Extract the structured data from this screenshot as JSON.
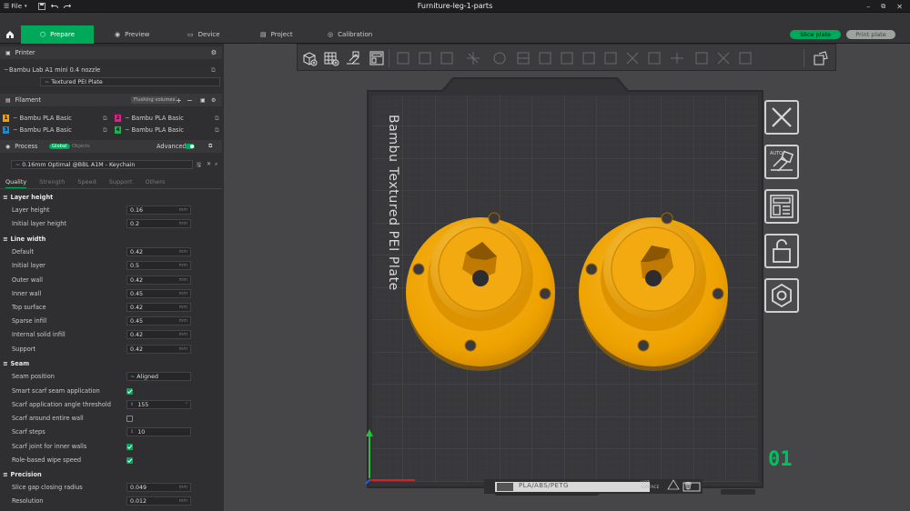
{
  "app": {
    "title": "Furniture-leg-1-parts",
    "menu_file": "File"
  },
  "tabs": [
    {
      "label": "Prepare",
      "icon": "cube-icon"
    },
    {
      "label": "Preview",
      "icon": "eye-icon"
    },
    {
      "label": "Device",
      "icon": "device-icon"
    },
    {
      "label": "Project",
      "icon": "project-icon"
    },
    {
      "label": "Calibration",
      "icon": "calibration-icon"
    }
  ],
  "actions": {
    "slice_plate": "Slice plate",
    "print_plate": "Print plate"
  },
  "printer": {
    "section_label": "Printer",
    "name": "Bambu Lab A1 mini 0.4 nozzle",
    "plate": "Textured PEI Plate"
  },
  "filament": {
    "section_label": "Filament",
    "flushing_label": "Flushing volumes",
    "slots": [
      {
        "num": "1",
        "name": "Bambu PLA Basic",
        "color": "#f0a000"
      },
      {
        "num": "2",
        "name": "Bambu PLA Basic",
        "color": "#e0208a"
      },
      {
        "num": "3",
        "name": "Bambu PLA Basic",
        "color": "#1e88d0"
      },
      {
        "num": "4",
        "name": "Bambu PLA Basic",
        "color": "#20b050"
      }
    ]
  },
  "process": {
    "section_label": "Process",
    "global_label": "Global",
    "objects_label": "Objects",
    "advanced_label": "Advanced",
    "preset": "0.16mm Optimal @BBL A1M - Keychain",
    "tabs": [
      "Quality",
      "Strength",
      "Speed",
      "Support",
      "Others"
    ]
  },
  "settings": {
    "layer_height": {
      "heading": "Layer height",
      "items": [
        {
          "label": "Layer height",
          "value": "0.16",
          "unit": "mm"
        },
        {
          "label": "Initial layer height",
          "value": "0.2",
          "unit": "mm"
        }
      ]
    },
    "line_width": {
      "heading": "Line width",
      "items": [
        {
          "label": "Default",
          "value": "0.42",
          "unit": "mm"
        },
        {
          "label": "Initial layer",
          "value": "0.5",
          "unit": "mm"
        },
        {
          "label": "Outer wall",
          "value": "0.42",
          "unit": "mm"
        },
        {
          "label": "Inner wall",
          "value": "0.45",
          "unit": "mm"
        },
        {
          "label": "Top surface",
          "value": "0.42",
          "unit": "mm"
        },
        {
          "label": "Sparse infill",
          "value": "0.45",
          "unit": "mm"
        },
        {
          "label": "Internal solid infill",
          "value": "0.42",
          "unit": "mm"
        },
        {
          "label": "Support",
          "value": "0.42",
          "unit": "mm"
        }
      ]
    },
    "seam": {
      "heading": "Seam",
      "seam_position_label": "Seam position",
      "seam_position_value": "Aligned",
      "smart_scarf_label": "Smart scarf seam application",
      "scarf_angle_label": "Scarf application angle threshold",
      "scarf_angle_value": "155",
      "scarf_angle_unit": "°",
      "scarf_entire_label": "Scarf around entire wall",
      "scarf_steps_label": "Scarf steps",
      "scarf_steps_value": "10",
      "scarf_inner_label": "Scarf joint for inner walls",
      "role_wipe_label": "Role-based wipe speed"
    },
    "precision": {
      "heading": "Precision",
      "items": [
        {
          "label": "Slice gap closing radius",
          "value": "0.049",
          "unit": "mm"
        },
        {
          "label": "Resolution",
          "value": "0.012",
          "unit": "mm"
        }
      ]
    }
  },
  "plate": {
    "label": "Bambu Textured PEI Plate",
    "material_label": "PLA/ABS/PETG",
    "hot_label_1": "HOT",
    "hot_label_2": "SURFACE",
    "plate_number": "01"
  },
  "colors": {
    "accent": "#00a85a",
    "part": "#f0a000"
  }
}
